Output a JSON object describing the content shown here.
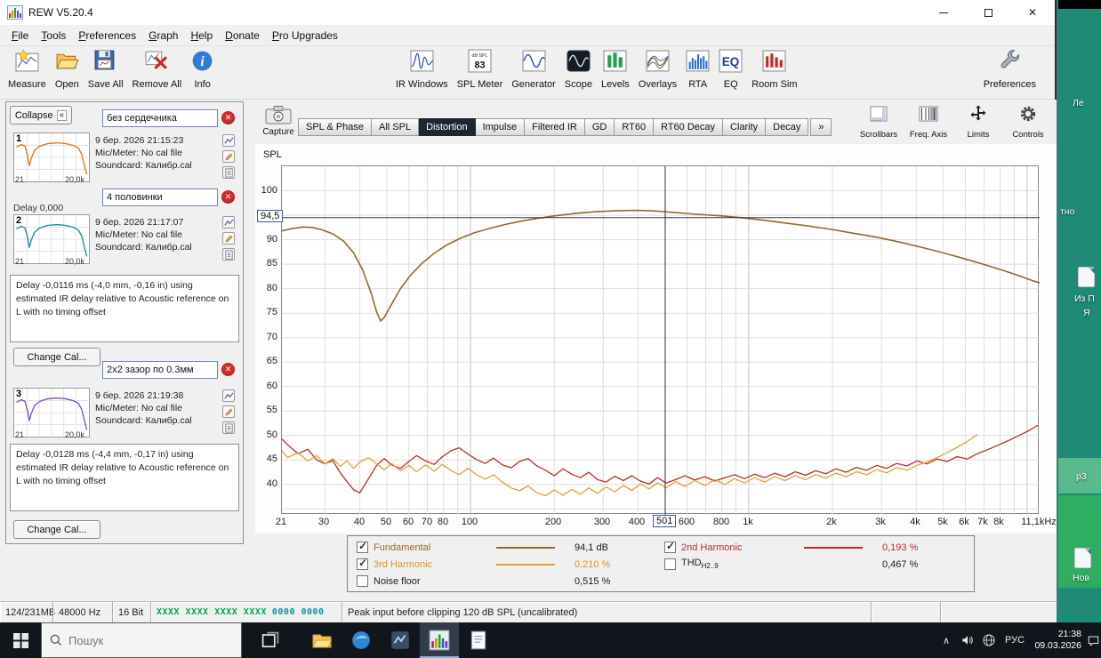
{
  "window": {
    "title": "REW V5.20.4"
  },
  "icons": {
    "close": "✕",
    "collapse_chevrons": "«",
    "tray_chevron": "∧"
  },
  "menu": {
    "items": [
      "File",
      "Tools",
      "Preferences",
      "Graph",
      "Help",
      "Donate",
      "Pro Upgrades"
    ]
  },
  "toolbar": {
    "left": [
      {
        "icon": "measure",
        "label": "Measure"
      },
      {
        "icon": "open",
        "label": "Open"
      },
      {
        "icon": "saveall",
        "label": "Save All"
      },
      {
        "icon": "removeall",
        "label": "Remove All"
      },
      {
        "icon": "info",
        "label": "Info"
      }
    ],
    "center": [
      {
        "icon": "irwindows",
        "label": "IR Windows"
      },
      {
        "icon": "splmeter",
        "label": "SPL Meter"
      },
      {
        "icon": "generator",
        "label": "Generator"
      },
      {
        "icon": "scope",
        "label": "Scope"
      },
      {
        "icon": "levels",
        "label": "Levels"
      },
      {
        "icon": "overlays",
        "label": "Overlays"
      },
      {
        "icon": "rta",
        "label": "RTA"
      },
      {
        "icon": "eq",
        "label": "EQ"
      },
      {
        "icon": "roomsim",
        "label": "Room Sim"
      }
    ],
    "right": [
      {
        "icon": "preferences",
        "label": "Preferences"
      }
    ],
    "spl_meter": {
      "top": "dB SPL",
      "value": "83"
    }
  },
  "graph_tabs": {
    "capture_label": "Capture",
    "tabs": [
      "SPL & Phase",
      "All SPL",
      "Distortion",
      "Impulse",
      "Filtered IR",
      "GD",
      "RT60",
      "RT60 Decay",
      "Clarity",
      "Decay"
    ],
    "active": "Distortion",
    "more": "»"
  },
  "right_buttons": [
    {
      "icon": "scrollbars",
      "label": "Scrollbars"
    },
    {
      "icon": "freqaxis",
      "label": "Freq. Axis"
    },
    {
      "icon": "limits",
      "label": "Limits"
    },
    {
      "icon": "controls",
      "label": "Controls"
    }
  ],
  "left_panel": {
    "collapse_label": "Collapse",
    "change_cal_label": "Change Cal...",
    "delay_fragment": "Delay 0,000",
    "measurements": [
      {
        "number": "1",
        "name": "без сердечника",
        "trace_color": "#e07820",
        "date": "9 бер. 2026 21:15:23",
        "mic": "Mic/Meter: No cal file",
        "soundcard": "Soundcard: Калибр.cal",
        "fmin": "21",
        "fmax": "20,0k",
        "delay": null
      },
      {
        "number": "2",
        "name": "4 половинки",
        "trace_color": "#1d8d96",
        "date": "9 бер. 2026 21:17:07",
        "mic": "Mic/Meter: No cal file",
        "soundcard": "Soundcard: Калибр.cal",
        "fmin": "21",
        "fmax": "20,0k",
        "delay": "Delay -0,0116 ms (-4,0 mm, -0,16 in) using estimated IR delay relative to Acoustic reference on  L with no timing offset"
      },
      {
        "number": "3",
        "name": "2x2 зазор по 0.3мм",
        "trace_color": "#8050c0",
        "date": "9 бер. 2026 21:19:38",
        "mic": "Mic/Meter: No cal file",
        "soundcard": "Soundcard: Калибр.cal",
        "fmin": "21",
        "fmax": "20,0k",
        "delay": "Delay -0,0128 ms (-4,4 mm, -0,17 in) using estimated IR delay relative to Acoustic reference on  L with no timing offset"
      }
    ]
  },
  "chart_data": {
    "type": "line",
    "title": "Distortion",
    "axis_title": "SPL",
    "x_scale": "log",
    "xlim": [
      21,
      11100
    ],
    "ylim": [
      33.8,
      105
    ],
    "grid": true,
    "yticks": [
      100,
      90,
      85,
      80,
      75,
      70,
      65,
      60,
      55,
      50,
      45,
      40
    ],
    "xticks": [
      {
        "f": 21,
        "t": "21"
      },
      {
        "f": 30,
        "t": "30"
      },
      {
        "f": 40,
        "t": "40"
      },
      {
        "f": 50,
        "t": "50"
      },
      {
        "f": 60,
        "t": "60"
      },
      {
        "f": 70,
        "t": "70"
      },
      {
        "f": 80,
        "t": "80"
      },
      {
        "f": 100,
        "t": "100"
      },
      {
        "f": 200,
        "t": "200"
      },
      {
        "f": 300,
        "t": "300"
      },
      {
        "f": 400,
        "t": "400"
      },
      {
        "f": 600,
        "t": "600"
      },
      {
        "f": 800,
        "t": "800"
      },
      {
        "f": 1000,
        "t": "1k"
      },
      {
        "f": 2000,
        "t": "2k"
      },
      {
        "f": 3000,
        "t": "3k"
      },
      {
        "f": 4000,
        "t": "4k"
      },
      {
        "f": 5000,
        "t": "5k"
      },
      {
        "f": 6000,
        "t": "6k"
      },
      {
        "f": 7000,
        "t": "7k"
      },
      {
        "f": 8000,
        "t": "8k"
      },
      {
        "f": 11100,
        "t": "11,1kHz"
      }
    ],
    "cursor": {
      "freq": 501,
      "spl": 94.5,
      "freq_label": "501",
      "spl_label": "94,5"
    },
    "series": [
      {
        "name": "Fundamental",
        "color": "#96682c",
        "width": 1.6,
        "points": [
          [
            21,
            91.8
          ],
          [
            23,
            92.3
          ],
          [
            25,
            92.6
          ],
          [
            27,
            92.5
          ],
          [
            29,
            92.1
          ],
          [
            32,
            91.2
          ],
          [
            35,
            89.7
          ],
          [
            38,
            87.3
          ],
          [
            41,
            83.8
          ],
          [
            44,
            79.0
          ],
          [
            46,
            75.2
          ],
          [
            47.5,
            73.4
          ],
          [
            49,
            74.1
          ],
          [
            52,
            76.8
          ],
          [
            56,
            80.0
          ],
          [
            61,
            82.8
          ],
          [
            67,
            85.2
          ],
          [
            74,
            87.2
          ],
          [
            82,
            88.9
          ],
          [
            92,
            90.3
          ],
          [
            103,
            91.4
          ],
          [
            117,
            92.3
          ],
          [
            133,
            93.1
          ],
          [
            152,
            93.8
          ],
          [
            175,
            94.4
          ],
          [
            203,
            94.9
          ],
          [
            238,
            95.4
          ],
          [
            280,
            95.7
          ],
          [
            330,
            95.9
          ],
          [
            390,
            96.0
          ],
          [
            450,
            95.9
          ],
          [
            501,
            95.7
          ],
          [
            560,
            95.5
          ],
          [
            650,
            95.2
          ],
          [
            780,
            94.9
          ],
          [
            940,
            94.5
          ],
          [
            1130,
            94.0
          ],
          [
            1360,
            93.4
          ],
          [
            1640,
            92.8
          ],
          [
            1980,
            92.1
          ],
          [
            2390,
            91.3
          ],
          [
            2890,
            90.5
          ],
          [
            3490,
            89.5
          ],
          [
            4210,
            88.4
          ],
          [
            5090,
            87.2
          ],
          [
            6150,
            85.9
          ],
          [
            7430,
            84.5
          ],
          [
            8980,
            83.0
          ],
          [
            10500,
            81.6
          ],
          [
            11100,
            81.2
          ]
        ]
      },
      {
        "name": "2nd Harmonic",
        "color": "#c02a2a",
        "width": 1.3,
        "points": [
          [
            21,
            49.3
          ],
          [
            22,
            48.1
          ],
          [
            24,
            46.3
          ],
          [
            26,
            47.2
          ],
          [
            28,
            45.0
          ],
          [
            30,
            44.2
          ],
          [
            32,
            44.9
          ],
          [
            34,
            42.4
          ],
          [
            36,
            40.6
          ],
          [
            38,
            38.9
          ],
          [
            40,
            38.3
          ],
          [
            43,
            41.2
          ],
          [
            46,
            43.9
          ],
          [
            49,
            45.3
          ],
          [
            52,
            44.0
          ],
          [
            56,
            43.3
          ],
          [
            60,
            44.7
          ],
          [
            64,
            45.9
          ],
          [
            69,
            44.8
          ],
          [
            74,
            44.1
          ],
          [
            79,
            45.6
          ],
          [
            85,
            46.9
          ],
          [
            91,
            47.5
          ],
          [
            98,
            46.2
          ],
          [
            105,
            45.1
          ],
          [
            113,
            44.3
          ],
          [
            121,
            45.4
          ],
          [
            130,
            44.0
          ],
          [
            140,
            43.4
          ],
          [
            150,
            44.7
          ],
          [
            161,
            45.3
          ],
          [
            173,
            43.8
          ],
          [
            186,
            42.9
          ],
          [
            200,
            41.8
          ],
          [
            215,
            43.2
          ],
          [
            231,
            42.1
          ],
          [
            248,
            41.4
          ],
          [
            266,
            42.5
          ],
          [
            286,
            41.0
          ],
          [
            307,
            40.5
          ],
          [
            330,
            41.7
          ],
          [
            354,
            40.8
          ],
          [
            380,
            41.8
          ],
          [
            408,
            40.7
          ],
          [
            438,
            40.1
          ],
          [
            470,
            41.4
          ],
          [
            505,
            40.3
          ],
          [
            545,
            41.0
          ],
          [
            590,
            41.8
          ],
          [
            640,
            40.9
          ],
          [
            695,
            41.6
          ],
          [
            755,
            40.7
          ],
          [
            820,
            41.4
          ],
          [
            890,
            42.0
          ],
          [
            965,
            41.2
          ],
          [
            1050,
            42.1
          ],
          [
            1140,
            41.4
          ],
          [
            1240,
            42.3
          ],
          [
            1350,
            41.6
          ],
          [
            1470,
            42.6
          ],
          [
            1600,
            41.9
          ],
          [
            1740,
            42.8
          ],
          [
            1890,
            42.2
          ],
          [
            2060,
            43.2
          ],
          [
            2240,
            42.5
          ],
          [
            2440,
            43.5
          ],
          [
            2650,
            42.9
          ],
          [
            2880,
            43.9
          ],
          [
            3130,
            43.3
          ],
          [
            3400,
            44.3
          ],
          [
            3700,
            43.8
          ],
          [
            4020,
            44.8
          ],
          [
            4370,
            44.2
          ],
          [
            4750,
            45.2
          ],
          [
            5160,
            44.7
          ],
          [
            5610,
            45.7
          ],
          [
            6100,
            45.2
          ],
          [
            6630,
            46.3
          ],
          [
            7210,
            47.1
          ],
          [
            7840,
            48.0
          ],
          [
            8520,
            48.9
          ],
          [
            9260,
            49.9
          ],
          [
            10070,
            50.9
          ],
          [
            10950,
            52.1
          ]
        ]
      },
      {
        "name": "3rd Harmonic",
        "color": "#e0a236",
        "width": 1.3,
        "points": [
          [
            21,
            46.9
          ],
          [
            22,
            45.5
          ],
          [
            24,
            46.5
          ],
          [
            26,
            44.8
          ],
          [
            28,
            45.9
          ],
          [
            30,
            44.2
          ],
          [
            32,
            45.3
          ],
          [
            34,
            43.7
          ],
          [
            36,
            44.8
          ],
          [
            38,
            43.3
          ],
          [
            40,
            44.6
          ],
          [
            43,
            45.5
          ],
          [
            46,
            44.2
          ],
          [
            49,
            43.0
          ],
          [
            52,
            44.3
          ],
          [
            56,
            42.8
          ],
          [
            60,
            43.9
          ],
          [
            64,
            42.6
          ],
          [
            69,
            44.0
          ],
          [
            74,
            42.7
          ],
          [
            79,
            44.1
          ],
          [
            85,
            42.9
          ],
          [
            91,
            42.0
          ],
          [
            98,
            43.3
          ],
          [
            105,
            42.0
          ],
          [
            113,
            41.1
          ],
          [
            121,
            42.0
          ],
          [
            130,
            40.5
          ],
          [
            140,
            39.3
          ],
          [
            150,
            38.7
          ],
          [
            161,
            39.7
          ],
          [
            173,
            38.3
          ],
          [
            186,
            37.7
          ],
          [
            200,
            38.9
          ],
          [
            215,
            37.8
          ],
          [
            231,
            39.0
          ],
          [
            248,
            38.0
          ],
          [
            266,
            39.3
          ],
          [
            286,
            38.2
          ],
          [
            307,
            39.5
          ],
          [
            330,
            38.5
          ],
          [
            354,
            39.8
          ],
          [
            380,
            38.8
          ],
          [
            408,
            40.1
          ],
          [
            438,
            39.1
          ],
          [
            470,
            40.3
          ],
          [
            505,
            39.3
          ],
          [
            545,
            40.6
          ],
          [
            590,
            39.6
          ],
          [
            640,
            40.8
          ],
          [
            695,
            39.8
          ],
          [
            755,
            41.0
          ],
          [
            820,
            40.0
          ],
          [
            890,
            41.2
          ],
          [
            965,
            40.3
          ],
          [
            1050,
            41.4
          ],
          [
            1140,
            40.5
          ],
          [
            1240,
            41.6
          ],
          [
            1350,
            40.8
          ],
          [
            1470,
            41.8
          ],
          [
            1600,
            41.0
          ],
          [
            1740,
            42.0
          ],
          [
            1890,
            41.3
          ],
          [
            2060,
            42.3
          ],
          [
            2240,
            41.6
          ],
          [
            2440,
            42.6
          ],
          [
            2650,
            42.0
          ],
          [
            2880,
            43.0
          ],
          [
            3130,
            42.4
          ],
          [
            3400,
            43.4
          ],
          [
            3700,
            42.9
          ],
          [
            4020,
            43.9
          ],
          [
            4370,
            44.6
          ],
          [
            4750,
            45.5
          ],
          [
            5160,
            46.5
          ],
          [
            5610,
            47.6
          ],
          [
            6100,
            48.8
          ],
          [
            6630,
            50.2
          ]
        ]
      }
    ]
  },
  "legend": {
    "rows": [
      [
        {
          "checked": true,
          "label": "Fundamental",
          "label_color": "#96682c",
          "line_color": "#96682c",
          "value": "94,1 dB",
          "value_color": "#1a1a1a"
        },
        {
          "checked": true,
          "label": "2nd Harmonic",
          "label_color": "#c02a2a",
          "line_color": "#c02a2a",
          "value": "0,193 %",
          "value_color": "#c02a2a"
        }
      ],
      [
        {
          "checked": true,
          "label": "3rd Harmonic",
          "label_color": "#d2962a",
          "line_color": "#e0a236",
          "value": "0,210 %",
          "value_color": "#d2962a"
        },
        {
          "checked": false,
          "label": "THD",
          "sub": "H2..9",
          "label_color": "#222222",
          "value": "0,467 %",
          "value_color": "#1a1a1a"
        }
      ],
      [
        {
          "checked": false,
          "label": "Noise floor",
          "label_color": "#222222",
          "value": "0,515 %",
          "value_color": "#1a1a1a"
        }
      ]
    ]
  },
  "status_bar": {
    "memory": "124/231MB",
    "sample_rate": "48000 Hz",
    "bits": "16 Bit",
    "input_flags_green": "XXXX XXXX XXXX XXXX",
    "input_flags_teal": "0000 0000",
    "peak": "Peak input before clipping 120 dB SPL (uncalibrated)"
  },
  "taskbar": {
    "search_placeholder": "Пошук",
    "language": "РУС",
    "time": "21:38",
    "date": "09.03.2026"
  },
  "desktop": {
    "fragments": [
      {
        "text": "Ле"
      },
      {
        "text": "тно"
      },
      {
        "text": "Из П"
      },
      {
        "text": "Я"
      },
      {
        "text": "р3"
      },
      {
        "text": "Нов"
      }
    ]
  }
}
